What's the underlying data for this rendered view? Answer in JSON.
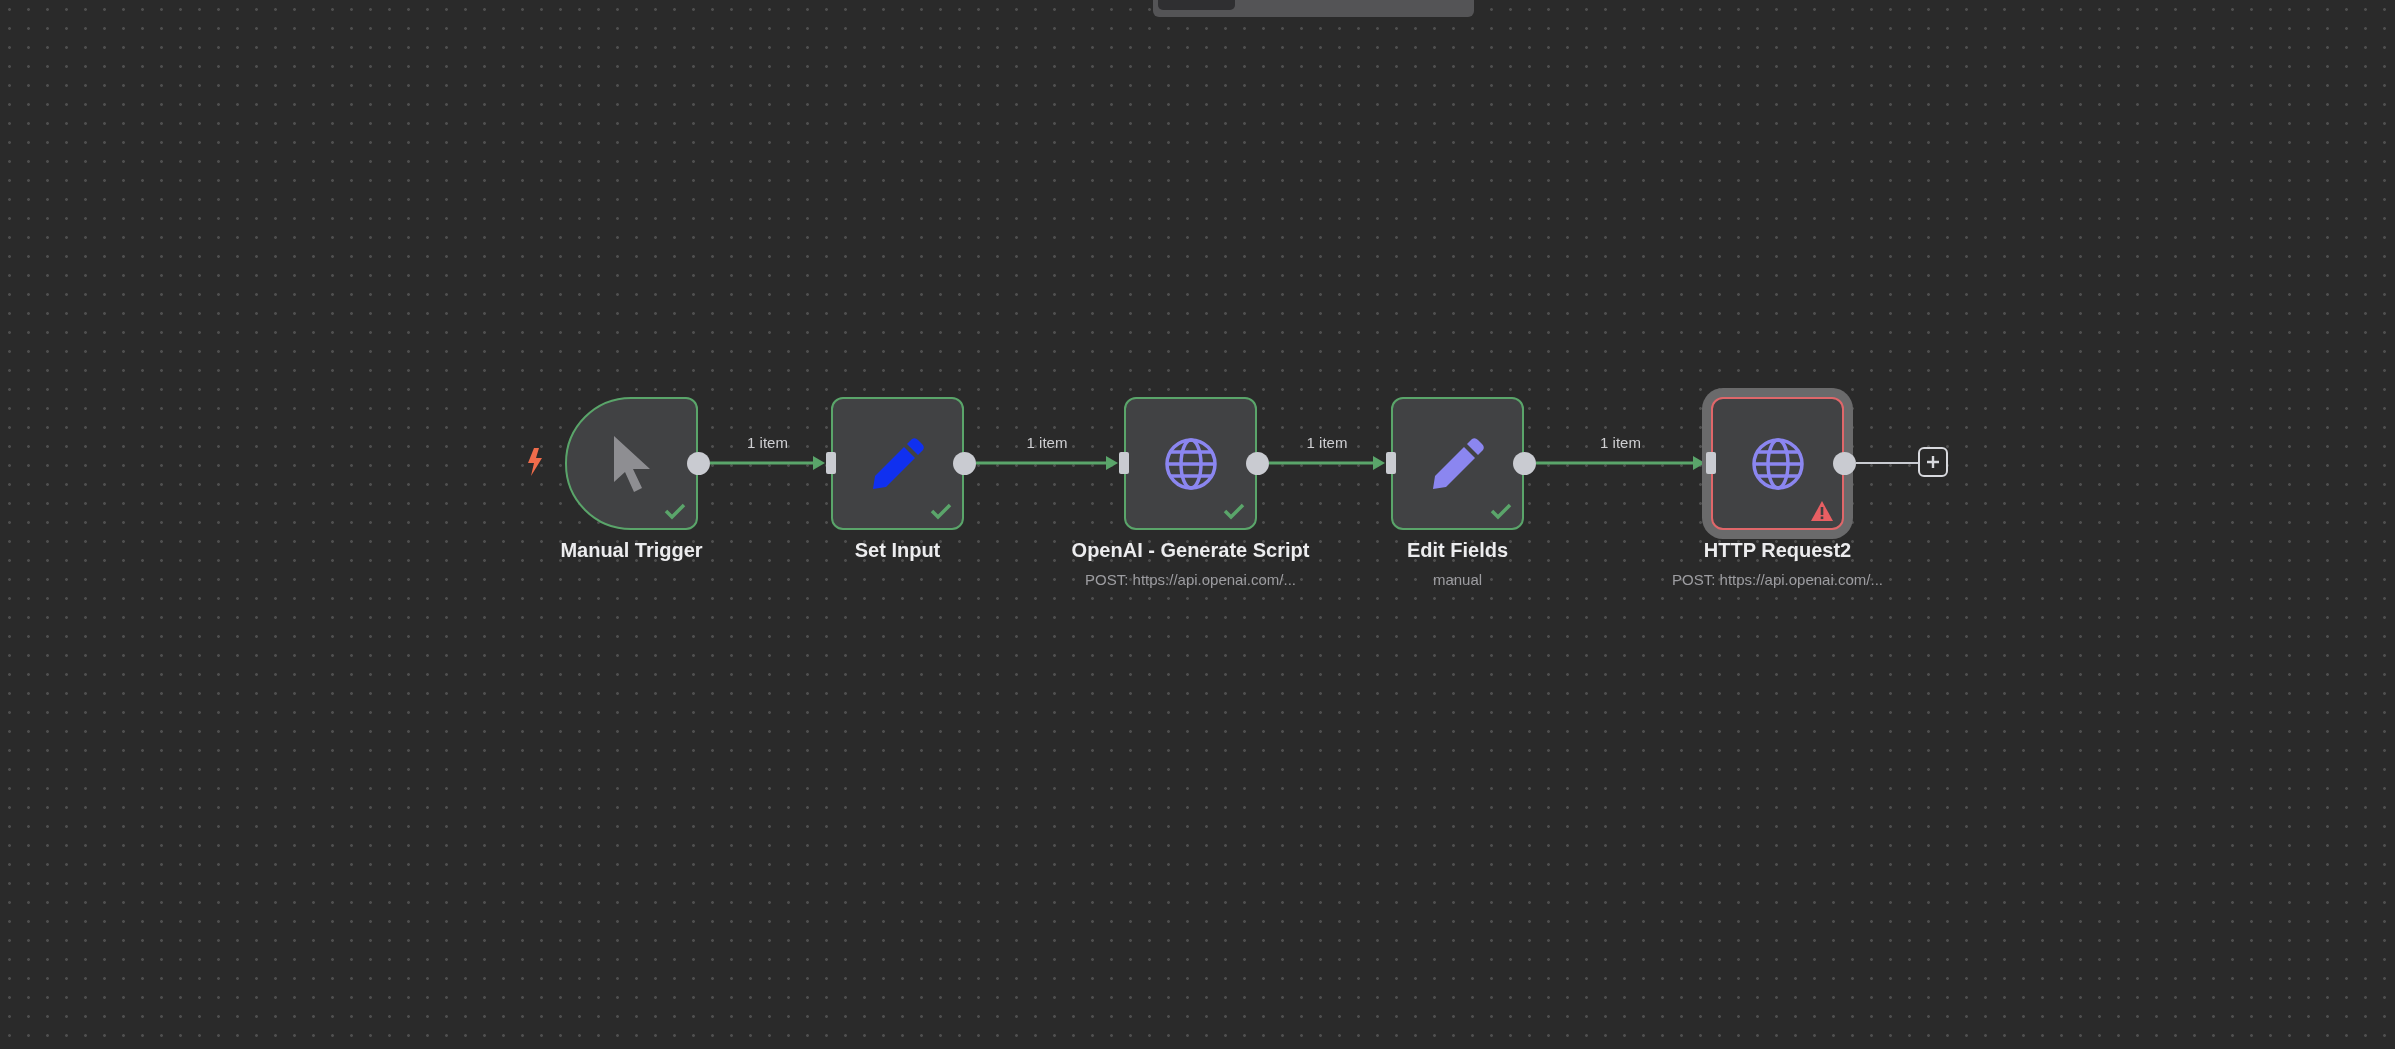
{
  "nodes": [
    {
      "name": "Manual Trigger",
      "kind": "trigger",
      "color": "#8e8e92",
      "error": false,
      "selected": false
    },
    {
      "name": "Set Input",
      "kind": "set",
      "color": "#1030f0",
      "error": false,
      "selected": false
    },
    {
      "name": "OpenAI - Generate Script",
      "subtitle": "POST: https://api.openai.com/...",
      "kind": "http",
      "color": "#8b86f0",
      "error": false,
      "selected": false
    },
    {
      "name": "Edit Fields",
      "subtitle": "manual",
      "kind": "set",
      "color": "#8b86f0",
      "error": false,
      "selected": false
    },
    {
      "name": "HTTP Request2",
      "subtitle": "POST: https://api.openai.com/...",
      "kind": "http",
      "color": "#8b86f0",
      "error": true,
      "selected": true
    }
  ],
  "connections": [
    {
      "label": "1 item"
    },
    {
      "label": "1 item"
    },
    {
      "label": "1 item"
    },
    {
      "label": "1 item"
    }
  ]
}
